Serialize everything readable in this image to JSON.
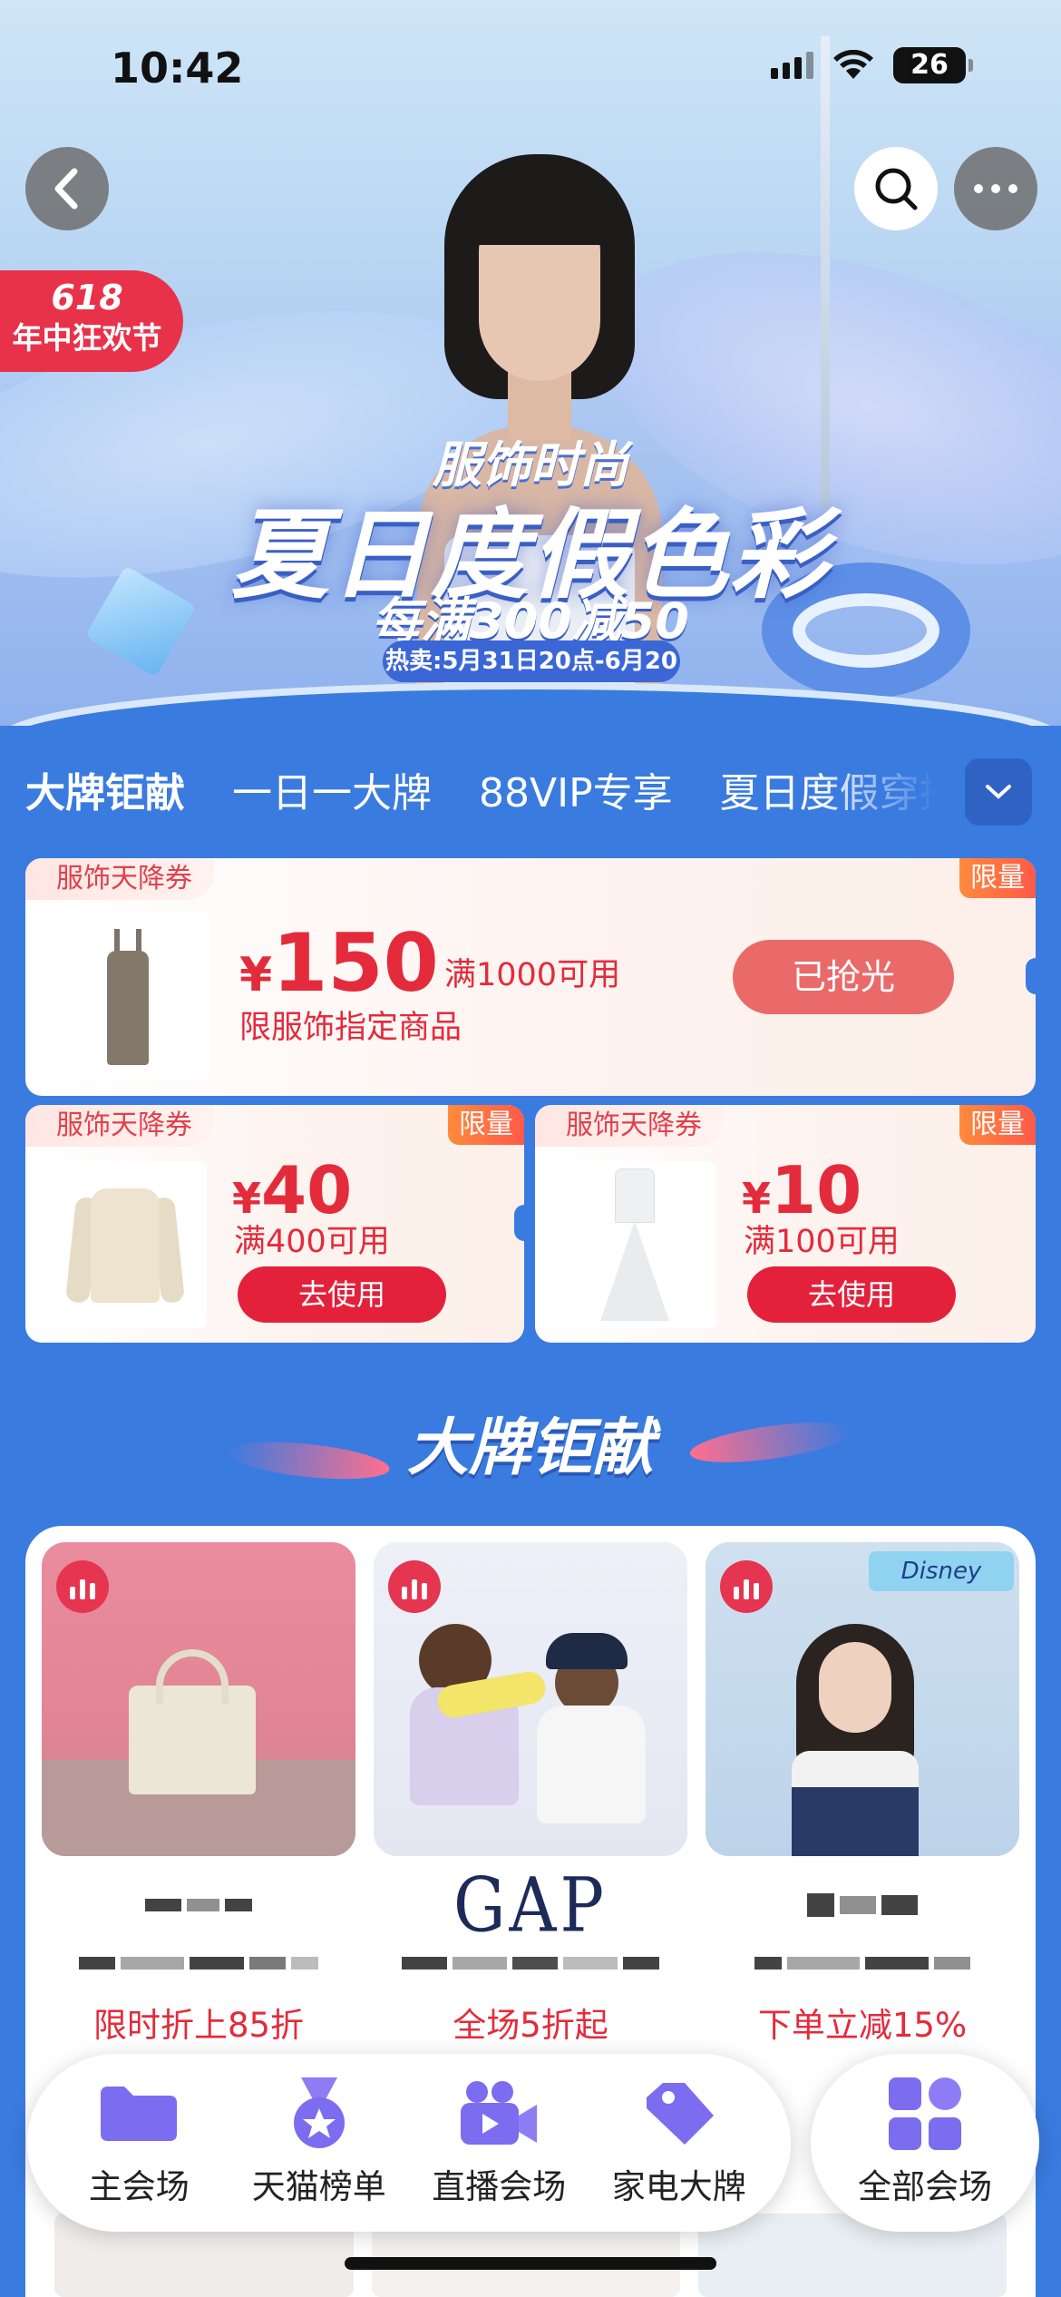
{
  "status_bar": {
    "time": "10:42",
    "battery": "26"
  },
  "hero": {
    "badge_line1": "618",
    "badge_line2": "年中狂欢节",
    "title_small": "服饰时尚",
    "title_big": "夏日度假色彩",
    "subtitle": "每满300减50",
    "date": "热卖:5月31日20点-6月20日"
  },
  "tabs": [
    "大牌钜献",
    "一日一大牌",
    "88VIP专享",
    "夏日度假穿搭"
  ],
  "coupons": [
    {
      "tag": "服饰天降券",
      "limit": "限量",
      "currency": "¥",
      "amount": "150",
      "condition": "满1000可用",
      "desc": "限服饰指定商品",
      "button": "已抢光"
    },
    {
      "tag": "服饰天降券",
      "limit": "限量",
      "currency": "¥",
      "amount": "40",
      "condition": "满400可用",
      "button": "去使用"
    },
    {
      "tag": "服饰天降券",
      "limit": "限量",
      "currency": "¥",
      "amount": "10",
      "condition": "满100可用",
      "button": "去使用"
    }
  ],
  "section_title": "大牌钜献",
  "brands": [
    {
      "logo": "",
      "promo": "限时折上85折"
    },
    {
      "logo": "GAP",
      "promo": "全场5折起"
    },
    {
      "logo": "",
      "promo": "下单立减15%",
      "image_tag": "Disney"
    }
  ],
  "bottom_nav": {
    "items": [
      {
        "label": "主会场",
        "icon": "folder-icon"
      },
      {
        "label": "天猫榜单",
        "icon": "medal-icon"
      },
      {
        "label": "直播会场",
        "icon": "video-camera-icon"
      },
      {
        "label": "家电大牌",
        "icon": "price-tag-icon"
      }
    ],
    "all_label": "全部会场"
  },
  "colors": {
    "accent_red": "#e42b3b",
    "page_blue": "#3a7be0",
    "nav_purple": "#7b6cf0"
  }
}
